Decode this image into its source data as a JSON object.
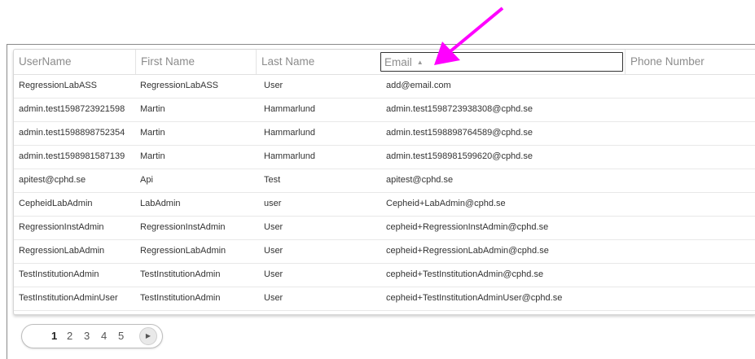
{
  "table": {
    "columns": [
      {
        "key": "username",
        "label": "UserName"
      },
      {
        "key": "first_name",
        "label": "First Name"
      },
      {
        "key": "last_name",
        "label": "Last Name"
      },
      {
        "key": "email",
        "label": "Email",
        "sort_icon": "sort-ascending-icon"
      },
      {
        "key": "phone",
        "label": "Phone Number"
      }
    ],
    "sorted_column": "email",
    "sort_direction": "ascending",
    "rows": [
      {
        "username": "RegressionLabASS",
        "first_name": "RegressionLabASS",
        "last_name": "User",
        "email": "add@email.com",
        "phone": ""
      },
      {
        "username": "admin.test1598723921598",
        "first_name": "Martin",
        "last_name": "Hammarlund",
        "email": "admin.test1598723938308@cphd.se",
        "phone": ""
      },
      {
        "username": "admin.test1598898752354",
        "first_name": "Martin",
        "last_name": "Hammarlund",
        "email": "admin.test1598898764589@cphd.se",
        "phone": ""
      },
      {
        "username": "admin.test1598981587139",
        "first_name": "Martin",
        "last_name": "Hammarlund",
        "email": "admin.test1598981599620@cphd.se",
        "phone": ""
      },
      {
        "username": "apitest@cphd.se",
        "first_name": "Api",
        "last_name": "Test",
        "email": "apitest@cphd.se",
        "phone": ""
      },
      {
        "username": "CepheidLabAdmin",
        "first_name": "LabAdmin",
        "last_name": "user",
        "email": "Cepheid+LabAdmin@cphd.se",
        "phone": ""
      },
      {
        "username": "RegressionInstAdmin",
        "first_name": "RegressionInstAdmin",
        "last_name": "User",
        "email": "cepheid+RegressionInstAdmin@cphd.se",
        "phone": ""
      },
      {
        "username": "RegressionLabAdmin",
        "first_name": "RegressionLabAdmin",
        "last_name": "User",
        "email": "cepheid+RegressionLabAdmin@cphd.se",
        "phone": ""
      },
      {
        "username": "TestInstitutionAdmin",
        "first_name": "TestInstitutionAdmin",
        "last_name": "User",
        "email": "cepheid+TestInstitutionAdmin@cphd.se",
        "phone": ""
      },
      {
        "username": "TestInstitutionAdminUser",
        "first_name": "TestInstitutionAdmin",
        "last_name": "User",
        "email": "cepheid+TestInstitutionAdminUser@cphd.se",
        "phone": ""
      }
    ]
  },
  "pagination": {
    "pages": [
      "1",
      "2",
      "3",
      "4",
      "5"
    ],
    "current_page": "1",
    "next_icon": "play-triangle-icon"
  },
  "annotation": {
    "arrow_icon": "pointer-arrow-icon",
    "color": "#ff00ff"
  },
  "colors": {
    "header_text": "#8c8c8c",
    "cell_text": "#333333",
    "row_border": "#e8e8e8",
    "sort_outline": "#333333"
  }
}
